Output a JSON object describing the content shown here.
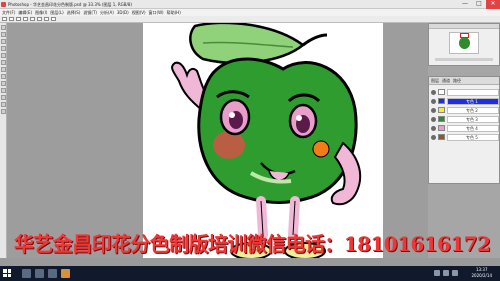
{
  "window": {
    "title": "Photoshop - 华艺金昌印花分色制版.psd @ 33.3% (图层 1, RGB/8)",
    "controls": {
      "minimize": "—",
      "maximize": "□",
      "close": "✕"
    }
  },
  "menubar": [
    "文件(F)",
    "编辑(E)",
    "图像(I)",
    "图层(L)",
    "选择(S)",
    "滤镜(T)",
    "分析(A)",
    "3D(D)",
    "视图(V)",
    "窗口(W)",
    "帮助(H)"
  ],
  "layers_panel": {
    "tabs": [
      "图层",
      "通道",
      "路径"
    ],
    "rows": [
      {
        "name": "",
        "swatch": "#ffffff",
        "selected": false
      },
      {
        "name": "专色 1",
        "swatch": "#1c2ee8",
        "selected": true
      },
      {
        "name": "专色 2",
        "swatch": "#f0ef3a",
        "selected": false
      },
      {
        "name": "专色 3",
        "swatch": "#2e8b2e",
        "selected": false
      },
      {
        "name": "专色 4",
        "swatch": "#e79ec9",
        "selected": false
      },
      {
        "name": "专色 5",
        "swatch": "#8a5a2a",
        "selected": false
      }
    ]
  },
  "caption": "华艺金昌印花分色制版培训微信电话：18101616172",
  "taskbar": {
    "time": "13:37",
    "date": "2020/2/14"
  },
  "colors": {
    "caption": "#f03636",
    "leaf": "#8fd27a",
    "apple": "#2e9c2e",
    "cheek": "#e84a4a",
    "orange_spot": "#f07c1a",
    "pink_limbs": "#f0b7d7",
    "selection_blue": "#1c2ee8"
  }
}
